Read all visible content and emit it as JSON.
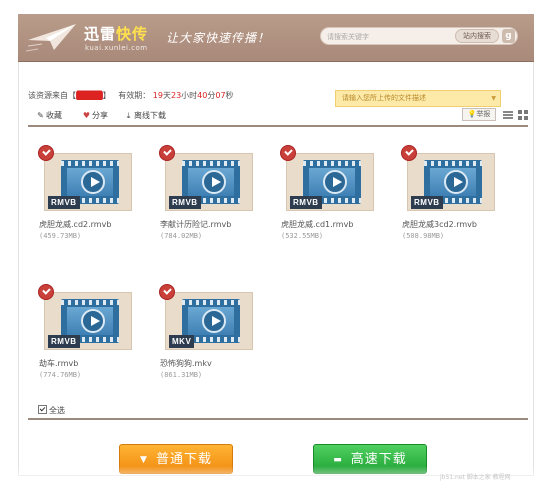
{
  "header": {
    "brand_part1": "迅雷",
    "brand_part2": "快传",
    "brand_url": "kuai.xunlei.com",
    "slogan": "让大家快速传播！",
    "search_placeholder": "请搜索关键字",
    "search_button": "站内搜索",
    "search_icon_letter": "g"
  },
  "info": {
    "source_prefix": "该资源来自【",
    "source_name": "████",
    "source_suffix": "】",
    "validity_label": "有效期：",
    "days": "19",
    "days_unit": "天",
    "hours": "23",
    "hours_unit": "小时",
    "minutes": "40",
    "minutes_unit": "分",
    "seconds": "07",
    "seconds_unit": "秒",
    "description_placeholder": "请输入您所上传的文件描述"
  },
  "toolbar": {
    "favorite": "收藏",
    "share": "分享",
    "offline_download": "离线下载",
    "report": "举报"
  },
  "files": [
    {
      "name": "虎胆龙威.cd2.rmvb",
      "size": "(459.73MB)",
      "format": "RMVB"
    },
    {
      "name": "李献计历险记.rmvb",
      "size": "(784.02MB)",
      "format": "RMVB"
    },
    {
      "name": "虎胆龙威.cd1.rmvb",
      "size": "(532.55MB)",
      "format": "RMVB"
    },
    {
      "name": "虎胆龙威3cd2.rmvb",
      "size": "(508.98MB)",
      "format": "RMVB"
    },
    {
      "name": "劫车.rmvb",
      "size": "(774.76MB)",
      "format": "RMVB"
    },
    {
      "name": "恐怖狗狗.mkv",
      "size": "(861.31MB)",
      "format": "MKV"
    }
  ],
  "footer": {
    "select_all": "全选",
    "normal_download": "普通下载",
    "fast_download": "高速下载",
    "watermark": "jb51.net 脚本之家 教程网"
  },
  "colors": {
    "header_bg": "#b39585",
    "brand_accent": "#ffe14d",
    "normal_button": "#f59a18",
    "fast_button": "#2fb843",
    "check_badge": "#c9403a",
    "expiry_red": "#d22222"
  }
}
